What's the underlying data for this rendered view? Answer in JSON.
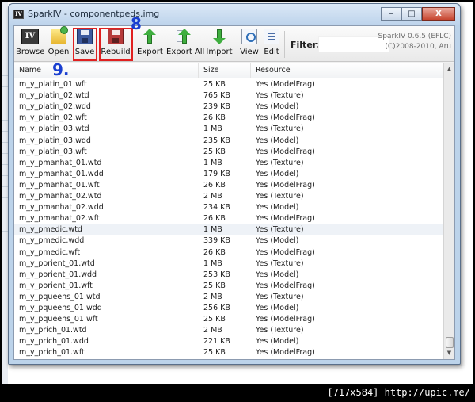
{
  "window": {
    "title": "SparkIV - componentpeds.img",
    "app_icon_text": "IV",
    "controls": {
      "minimize": "–",
      "maximize": "□",
      "close": "X"
    }
  },
  "toolbar": {
    "buttons": [
      {
        "id": "browse",
        "label": "Browse",
        "icon": "browse-icon"
      },
      {
        "id": "open",
        "label": "Open",
        "icon": "folder-open-icon"
      },
      {
        "id": "save",
        "label": "Save",
        "icon": "floppy-disk-icon"
      },
      {
        "id": "rebuild",
        "label": "Rebuild",
        "icon": "floppy-rebuild-icon"
      },
      {
        "id": "export",
        "label": "Export",
        "icon": "export-arrow-icon"
      },
      {
        "id": "export_all",
        "label": "Export All",
        "icon": "export-all-arrow-icon"
      },
      {
        "id": "import",
        "label": "Import",
        "icon": "import-arrow-icon"
      },
      {
        "id": "view",
        "label": "View",
        "icon": "view-document-icon"
      },
      {
        "id": "edit",
        "label": "Edit",
        "icon": "edit-document-icon"
      }
    ],
    "filter_label": "Filter:",
    "filter_value": "",
    "version_line1": "SparkIV 0.6.5 (EFLC)",
    "version_line2": "(C)2008-2010, Aru"
  },
  "annotations": {
    "step_8": "8",
    "step_9": "9."
  },
  "list": {
    "columns": [
      "Name",
      "Size",
      "Resource"
    ],
    "highlighted_index": 13,
    "rows": [
      {
        "name": "m_y_platin_01.wft",
        "size": "25 KB",
        "resource": "Yes (ModelFrag)"
      },
      {
        "name": "m_y_platin_02.wtd",
        "size": "765 KB",
        "resource": "Yes (Texture)"
      },
      {
        "name": "m_y_platin_02.wdd",
        "size": "239 KB",
        "resource": "Yes (Model)"
      },
      {
        "name": "m_y_platin_02.wft",
        "size": "26 KB",
        "resource": "Yes (ModelFrag)"
      },
      {
        "name": "m_y_platin_03.wtd",
        "size": "1 MB",
        "resource": "Yes (Texture)"
      },
      {
        "name": "m_y_platin_03.wdd",
        "size": "235 KB",
        "resource": "Yes (Model)"
      },
      {
        "name": "m_y_platin_03.wft",
        "size": "25 KB",
        "resource": "Yes (ModelFrag)"
      },
      {
        "name": "m_y_pmanhat_01.wtd",
        "size": "1 MB",
        "resource": "Yes (Texture)"
      },
      {
        "name": "m_y_pmanhat_01.wdd",
        "size": "179 KB",
        "resource": "Yes (Model)"
      },
      {
        "name": "m_y_pmanhat_01.wft",
        "size": "26 KB",
        "resource": "Yes (ModelFrag)"
      },
      {
        "name": "m_y_pmanhat_02.wtd",
        "size": "2 MB",
        "resource": "Yes (Texture)"
      },
      {
        "name": "m_y_pmanhat_02.wdd",
        "size": "234 KB",
        "resource": "Yes (Model)"
      },
      {
        "name": "m_y_pmanhat_02.wft",
        "size": "26 KB",
        "resource": "Yes (ModelFrag)"
      },
      {
        "name": "m_y_pmedic.wtd",
        "size": "1 MB",
        "resource": "Yes (Texture)"
      },
      {
        "name": "m_y_pmedic.wdd",
        "size": "339 KB",
        "resource": "Yes (Model)"
      },
      {
        "name": "m_y_pmedic.wft",
        "size": "26 KB",
        "resource": "Yes (ModelFrag)"
      },
      {
        "name": "m_y_porient_01.wtd",
        "size": "1 MB",
        "resource": "Yes (Texture)"
      },
      {
        "name": "m_y_porient_01.wdd",
        "size": "253 KB",
        "resource": "Yes (Model)"
      },
      {
        "name": "m_y_porient_01.wft",
        "size": "25 KB",
        "resource": "Yes (ModelFrag)"
      },
      {
        "name": "m_y_pqueens_01.wtd",
        "size": "2 MB",
        "resource": "Yes (Texture)"
      },
      {
        "name": "m_y_pqueens_01.wdd",
        "size": "256 KB",
        "resource": "Yes (Model)"
      },
      {
        "name": "m_y_pqueens_01.wft",
        "size": "25 KB",
        "resource": "Yes (ModelFrag)"
      },
      {
        "name": "m_y_prich_01.wtd",
        "size": "2 MB",
        "resource": "Yes (Texture)"
      },
      {
        "name": "m_y_prich_01.wdd",
        "size": "221 KB",
        "resource": "Yes (Model)"
      },
      {
        "name": "m_y_prich_01.wft",
        "size": "25 KB",
        "resource": "Yes (ModelFrag)"
      }
    ]
  },
  "watermark": "[717x584] http://upic.me/"
}
